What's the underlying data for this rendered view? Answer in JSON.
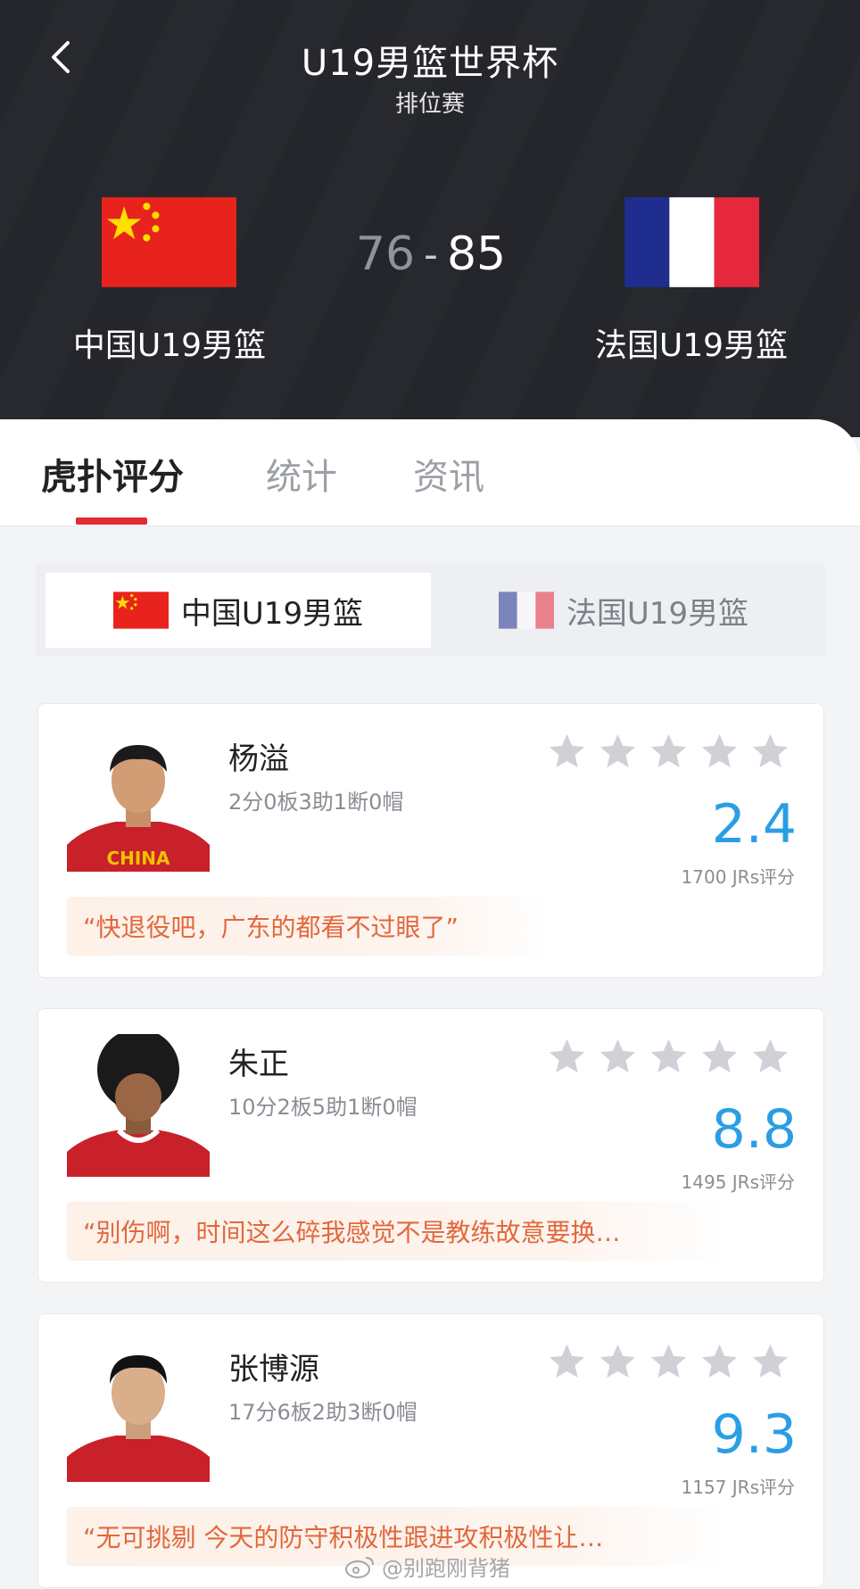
{
  "header": {
    "title": "U19男篮世界杯",
    "subtitle": "排位赛",
    "home": {
      "name": "中国U19男篮",
      "score": "76",
      "flag_icon": "china-flag-icon"
    },
    "score_separator": "-",
    "away": {
      "name": "法国U19男篮",
      "score": "85",
      "flag_icon": "france-flag-icon"
    }
  },
  "tabs": [
    {
      "label": "虎扑评分",
      "active": true
    },
    {
      "label": "统计",
      "active": false
    },
    {
      "label": "资讯",
      "active": false
    }
  ],
  "team_switch": {
    "home_label": "中国U19男篮",
    "away_label": "法国U19男篮",
    "selected": "home"
  },
  "players": [
    {
      "name": "杨溢",
      "stats": "2分0板3助1断0帽",
      "rating": "2.4",
      "votes": "1700 JRs评分",
      "quote": "“快退役吧，广东的都看不过眼了”"
    },
    {
      "name": "朱正",
      "stats": "10分2板5助1断0帽",
      "rating": "8.8",
      "votes": "1495 JRs评分",
      "quote": "“别伤啊，时间这么碎我感觉不是教练故意要换…"
    },
    {
      "name": "张博源",
      "stats": "17分6板2助3断0帽",
      "rating": "9.3",
      "votes": "1157 JRs评分",
      "quote": "“无可挑剔 今天的防守积极性跟进攻积极性让…"
    }
  ],
  "watermark": "@别跑刚背猪",
  "colors": {
    "header_bg": "#24262b",
    "tab_accent": "#e02a36",
    "rating_blue": "#2a9ee4",
    "quote_orange": "#e2683c",
    "star_gray": "#cfd1d7"
  }
}
